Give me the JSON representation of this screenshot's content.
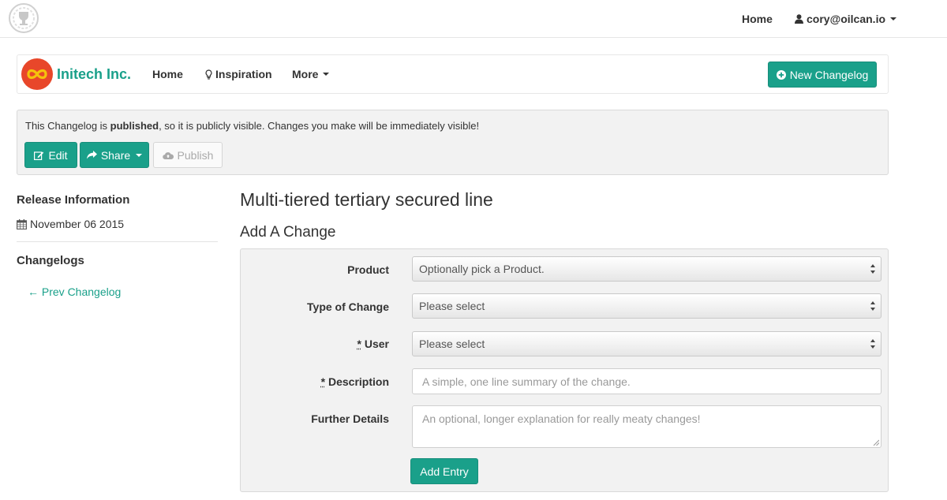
{
  "topbar": {
    "home_label": "Home",
    "user_label": "cory@oilcan.io",
    "logo_icon": "trophy-badge-icon"
  },
  "navbar": {
    "brand_name": "Initech Inc.",
    "brand_icon": "infinity-logo-icon",
    "links": [
      {
        "label": "Home"
      },
      {
        "label": "Inspiration",
        "icon": "lightbulb-icon"
      },
      {
        "label": "More",
        "icon": "caret-down-icon"
      }
    ],
    "new_button_label": "New Changelog",
    "new_button_icon": "plus-circle-icon"
  },
  "notice": {
    "text_before": "This Changelog is ",
    "text_bold": "published",
    "text_after": ", so it is publicly visible. Changes you make will be immediately visible!",
    "edit_label": "Edit",
    "share_label": "Share",
    "publish_label": "Publish"
  },
  "sidebar": {
    "release_heading": "Release Information",
    "date": "November 06 2015",
    "changelogs_heading": "Changelogs",
    "prev_link": "← Prev Changelog"
  },
  "main": {
    "title": "Multi-tiered tertiary secured line",
    "subtitle": "Add A Change"
  },
  "form": {
    "product_label": "Product",
    "product_value": "Optionally pick a Product.",
    "type_label": "Type of Change",
    "type_value": "Please select",
    "user_required_mark": "*",
    "user_label": " User",
    "user_value": "Please select",
    "description_required_mark": "*",
    "description_label": " Description",
    "description_placeholder": "A simple, one line summary of the change.",
    "details_label": "Further Details",
    "details_placeholder": "An optional, longer explanation for really meaty changes!",
    "submit_label": "Add Entry"
  },
  "colors": {
    "accent": "#1aa08a",
    "panel_bg": "#f2f2f2",
    "text": "#333333"
  }
}
